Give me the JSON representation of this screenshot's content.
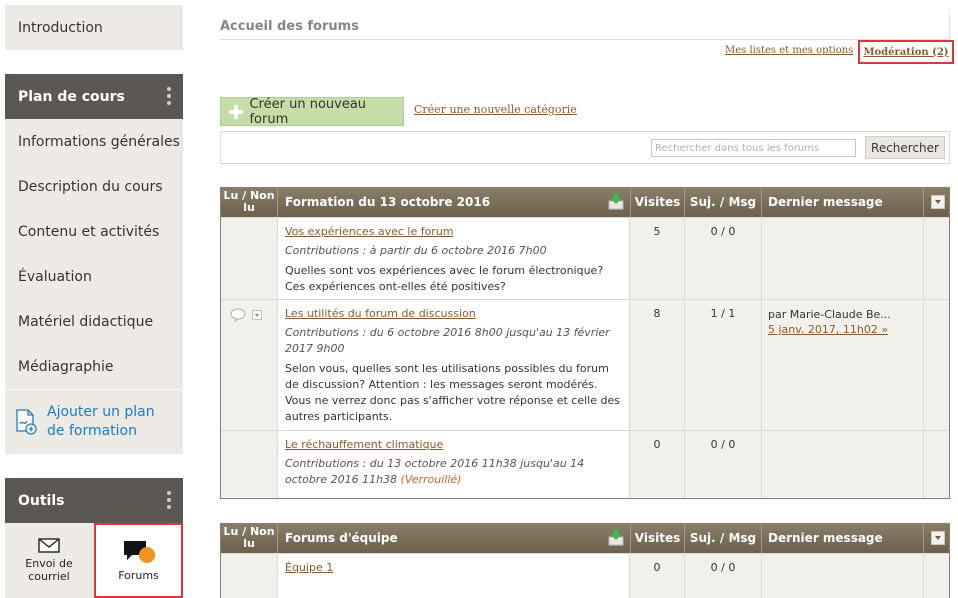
{
  "sidebar": {
    "intro": "Introduction",
    "plan_header": "Plan de cours",
    "plan_items": [
      "Informations générales",
      "Description du cours",
      "Contenu et activités",
      "Évaluation",
      "Matériel didactique",
      "Médiagraphie"
    ],
    "add_plan": "Ajouter un plan de formation",
    "tools_header": "Outils",
    "tools": {
      "mail": "Envoi de courriel",
      "forums": "Forums"
    }
  },
  "main": {
    "title": "Accueil des forums",
    "links": {
      "lists": "Mes listes et mes options",
      "moderation": "Modération (2)"
    },
    "create_forum": "Créer un nouveau forum",
    "create_category": "Créer une nouvelle catégorie",
    "search_placeholder": "Rechercher dans tous les forums",
    "search_button": "Rechercher"
  },
  "columns": {
    "lu": "Lu / Non lu",
    "visits": "Visites",
    "topics": "Suj. / Msg",
    "last": "Dernier message"
  },
  "table1": {
    "title": "Formation du 13 octobre 2016",
    "rows": [
      {
        "name": "Vos expériences avec le forum",
        "contrib": "Contributions : à partir du 6 octobre 2016 7h00",
        "desc": "Quelles sont vos expériences avec le forum électronique? Ces expériences ont-elles été positives?",
        "visits": "5",
        "topics": "0 / 0"
      },
      {
        "name": "Les utilités du forum de discussion",
        "contrib": "Contributions : du 6 octobre 2016 8h00 jusqu'au 13 février 2017 9h00",
        "desc": "Selon vous, quelles sont les utilisations possibles du forum de discussion? Attention : les messages seront modérés. Vous ne verrez donc pas s'afficher votre réponse et celle des autres participants.",
        "visits": "8",
        "topics": "1 / 1",
        "last_by": "par Marie-Claude Be...",
        "last_date": "5 janv. 2017, 11h02 »"
      },
      {
        "name": "Le réchauffement climatique",
        "contrib": "Contributions : du 13 octobre 2016 11h38 jusqu'au 14 octobre 2016 11h38",
        "locked": "(Verrouillé)",
        "visits": "0",
        "topics": "0 / 0"
      }
    ]
  },
  "table2": {
    "title": "Forums d'équipe",
    "rows": [
      {
        "name": "Équipe 1",
        "visits": "0",
        "topics": "0 / 0"
      }
    ]
  },
  "colors": {
    "header_dark": "#5b5752",
    "table_header": "#7c6f5c",
    "link": "#8b5a2b",
    "accent_blue": "#1f7bc1",
    "highlight_red": "#e0353a",
    "forum_dot": "#f39323",
    "create_green": "#c5dda7"
  }
}
